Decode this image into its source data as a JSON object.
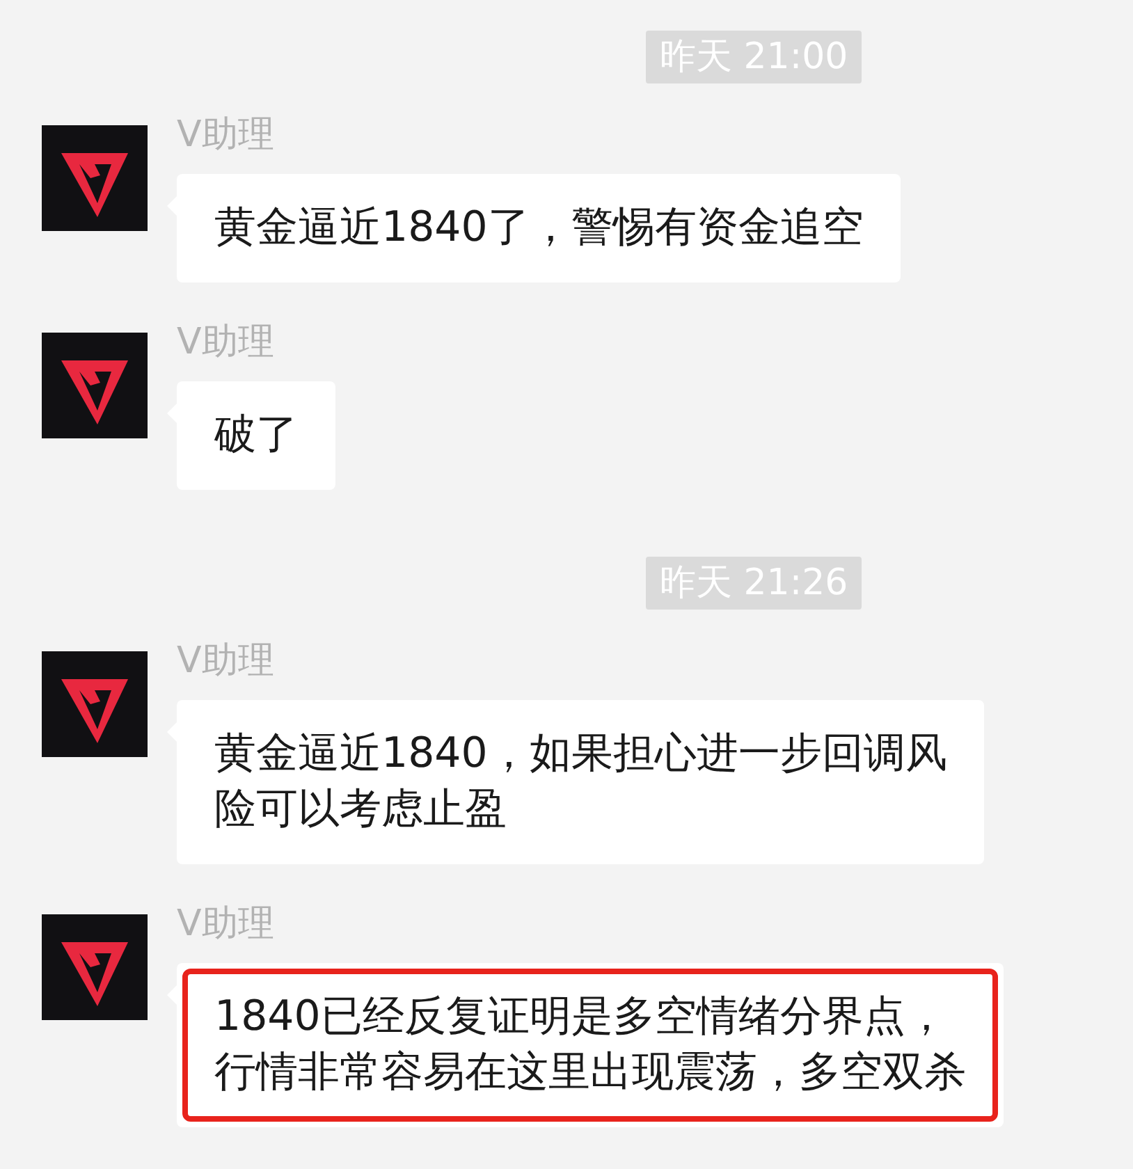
{
  "chat": [
    {
      "kind": "time",
      "text": "昨天 21:00"
    },
    {
      "kind": "message",
      "sender": "V助理",
      "lines": [
        "黄金逼近1840了，警惕有资金追空"
      ],
      "highlighted": false
    },
    {
      "kind": "message",
      "sender": "V助理",
      "lines": [
        "破了"
      ],
      "highlighted": false
    },
    {
      "kind": "time",
      "text": "昨天 21:26"
    },
    {
      "kind": "message",
      "sender": "V助理",
      "lines": [
        "黄金逼近1840，如果担心进一步回调风",
        "险可以考虑止盈"
      ],
      "highlighted": false
    },
    {
      "kind": "message",
      "sender": "V助理",
      "lines": [
        "1840已经反复证明是多空情绪分界点，",
        "行情非常容易在这里出现震荡，多空双杀"
      ],
      "highlighted": true
    }
  ]
}
